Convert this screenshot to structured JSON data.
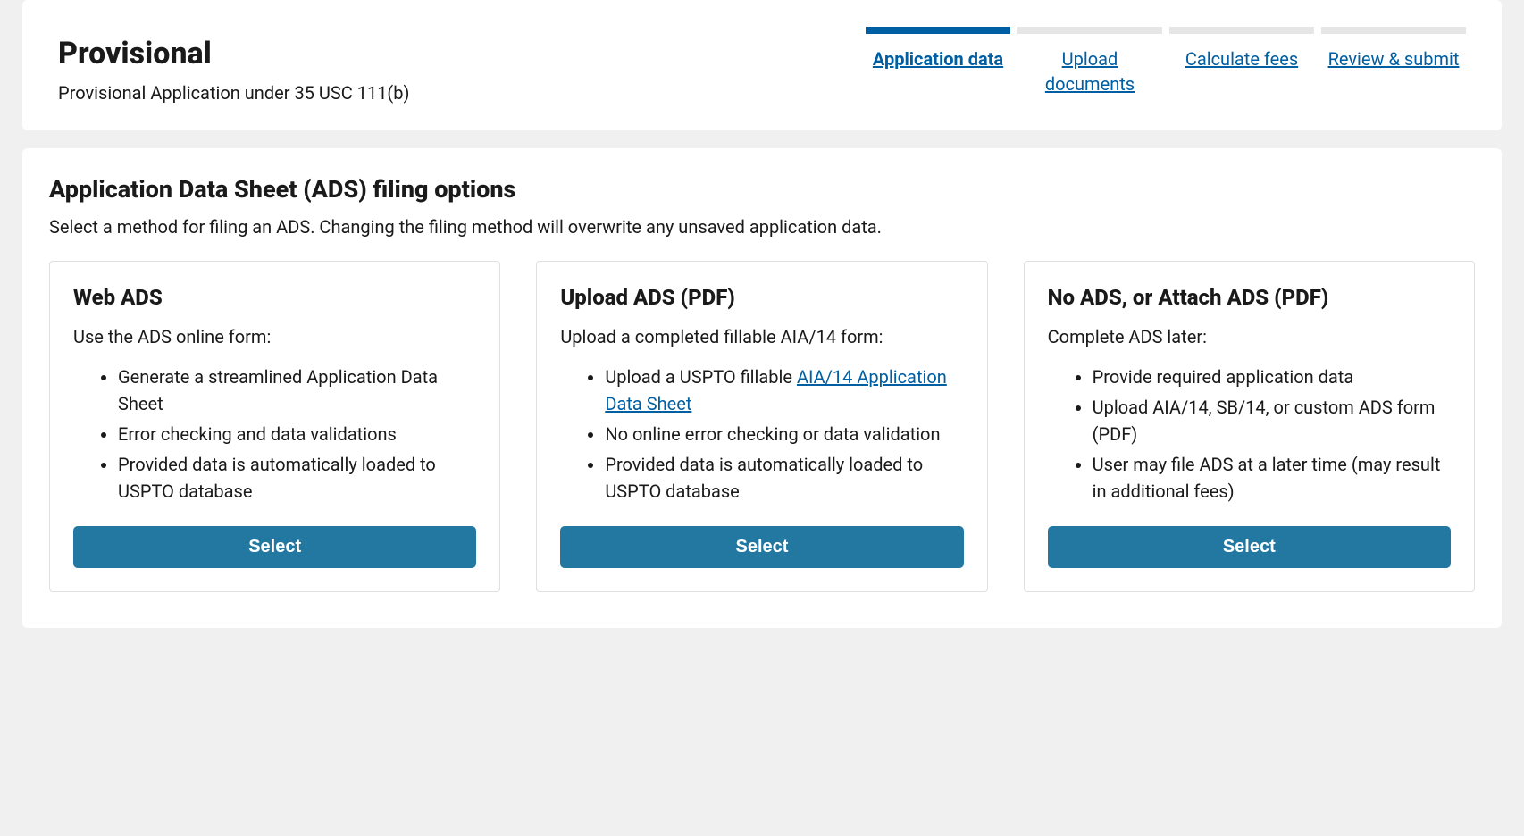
{
  "header": {
    "title": "Provisional",
    "subtitle": "Provisional Application under 35 USC 111(b)"
  },
  "stepper": {
    "steps": [
      {
        "label": "Application data",
        "active": true
      },
      {
        "label": "Upload documents",
        "active": false
      },
      {
        "label": "Calculate fees",
        "active": false
      },
      {
        "label": "Review & submit",
        "active": false
      }
    ]
  },
  "section": {
    "title": "Application Data Sheet (ADS) filing options",
    "subtitle": "Select a method for filing an ADS. Changing the filing method will overwrite any unsaved application data."
  },
  "options": [
    {
      "title": "Web ADS",
      "intro": "Use the ADS online form:",
      "bullets": [
        "Generate a streamlined Application Data Sheet",
        "Error checking and data validations",
        "Provided data is automatically loaded to USPTO database"
      ],
      "button": "Select"
    },
    {
      "title": "Upload ADS (PDF)",
      "intro": "Upload a completed fillable AIA/14 form:",
      "bullets_mixed": {
        "b0_pre": "Upload a USPTO fillable ",
        "b0_link": "AIA/14 Application Data Sheet",
        "b1": "No online error checking or data validation",
        "b2": "Provided data is automatically loaded to USPTO database"
      },
      "button": "Select"
    },
    {
      "title": "No ADS, or Attach ADS (PDF)",
      "intro": "Complete ADS later:",
      "bullets": [
        "Provide required application data",
        "Upload AIA/14, SB/14, or custom ADS form (PDF)",
        "User may file ADS at a later time (may result in additional fees)"
      ],
      "button": "Select"
    }
  ]
}
